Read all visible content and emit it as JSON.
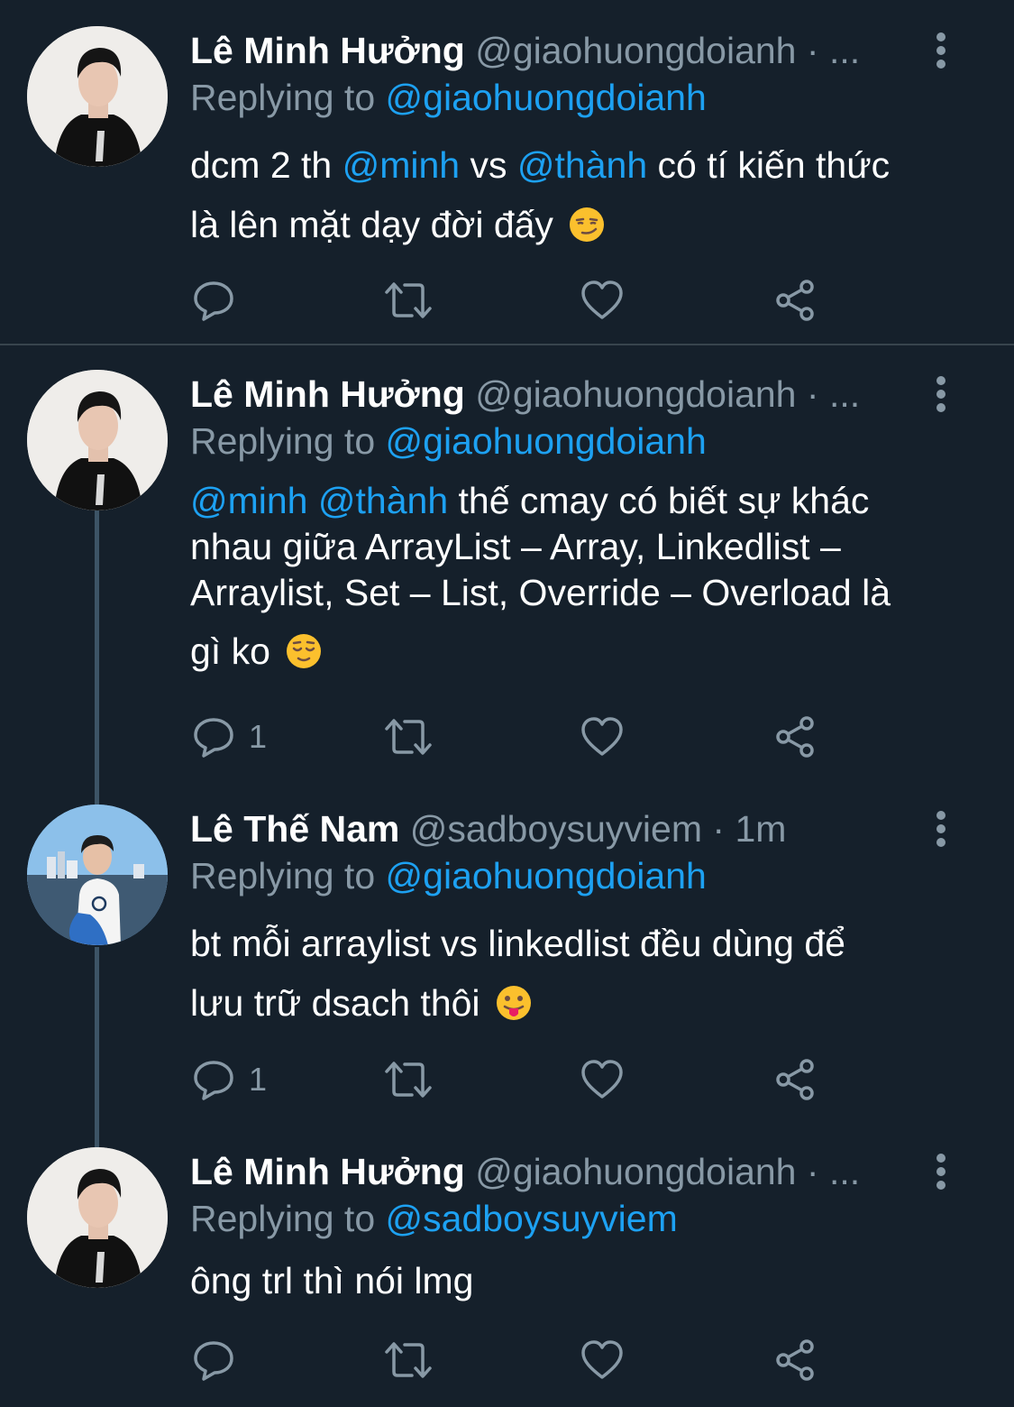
{
  "tweets": [
    {
      "name": "Lê Minh Hưởng",
      "handle": "@giaohuongdoianh",
      "meta": "· ...",
      "replying_prefix": "Replying to",
      "replying_handle": "@giaohuongdoianh",
      "body_line1_a": "dcm 2 th ",
      "body_line1_m1": "@minh",
      "body_line1_b": " vs ",
      "body_line1_m2": "@thành",
      "body_line1_c": " có tí kiến thức",
      "body_line2": "là lên mặt dạy đời đấy",
      "emoji": "smirking-face",
      "reply_count": ""
    },
    {
      "name": "Lê Minh Hưởng",
      "handle": "@giaohuongdoianh",
      "meta": "· ...",
      "replying_prefix": "Replying to",
      "replying_handle": "@giaohuongdoianh",
      "mention1": "@minh",
      "mention2": "@thành",
      "body_line1_rest": " thế cmay có biết sự khác",
      "body_line2": "nhau giữa ArrayList – Array, Linkedlist –",
      "body_line3": "Arraylist, Set – List, Override – Overload là",
      "body_line4": "gì ko",
      "emoji": "relieved-face",
      "reply_count": "1"
    },
    {
      "name": "Lê Thế Nam",
      "handle": "@sadboysuyviem",
      "meta": "· 1m",
      "replying_prefix": "Replying to",
      "replying_handle": "@giaohuongdoianh",
      "body_line1": "bt mỗi arraylist vs linkedlist đều dùng để",
      "body_line2": "lưu trữ dsach thôi",
      "emoji": "face-with-tongue",
      "reply_count": "1"
    },
    {
      "name": "Lê Minh Hưởng",
      "handle": "@giaohuongdoianh",
      "meta": "· ...",
      "replying_prefix": "Replying to",
      "replying_handle": "@sadboysuyviem",
      "body_line1": "ông trl thì nói lmg",
      "reply_count": ""
    }
  ],
  "icons": {
    "reply": "reply-bubble-icon",
    "retweet": "retweet-icon",
    "like": "heart-icon",
    "share": "share-icon",
    "more": "vertical-ellipsis-icon"
  },
  "colors": {
    "background": "#15202b",
    "text_primary": "#ffffff",
    "text_secondary": "#8899a6",
    "accent": "#1da1f2",
    "divider": "#38444d",
    "thread_line": "#3d5466"
  }
}
